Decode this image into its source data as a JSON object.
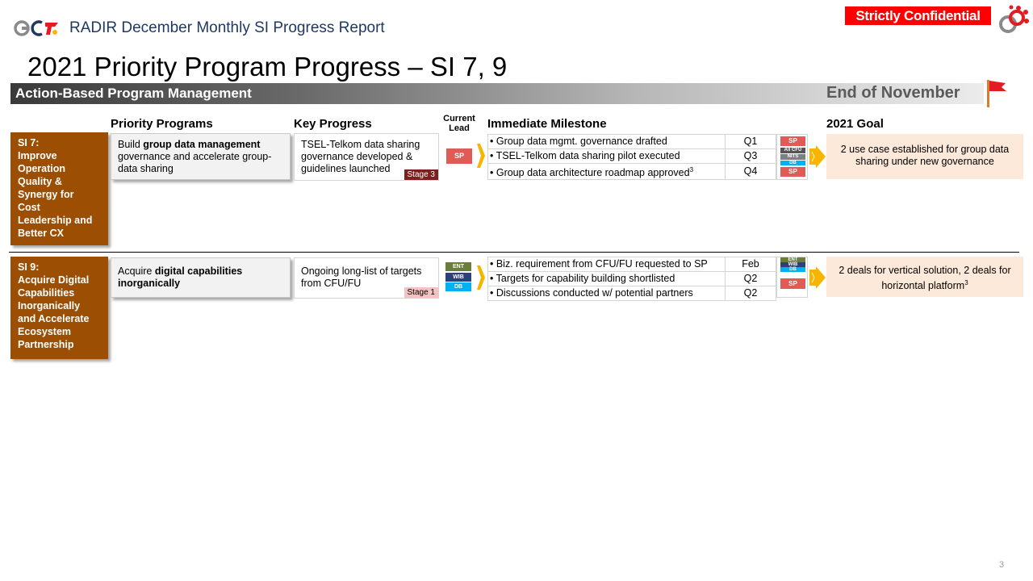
{
  "header": {
    "report_title": "RADIR December Monthly SI Progress Report",
    "confidential": "Strictly Confidential",
    "page_title": "2021 Priority Program Progress – SI 7, 9",
    "banner_left": "Action-Based Program Management",
    "banner_right": "End of November"
  },
  "columns": {
    "priority_programs": "Priority Programs",
    "key_progress": "Key Progress",
    "current_lead_1": "Current",
    "current_lead_2": "Lead",
    "immediate_milestone": "Immediate Milestone",
    "goal": "2021 Goal"
  },
  "si7": {
    "label": "SI 7:",
    "title_lines": [
      "Improve",
      "Operation",
      "Quality &",
      "Synergy for",
      "Cost",
      "Leadership and",
      "Better CX"
    ],
    "program_pre": "Build ",
    "program_bold": "group data management",
    "program_post": " governance and accelerate group-data sharing",
    "progress": "TSEL-Telkom data sharing governance developed & guidelines launched",
    "stage": "Stage 3",
    "lead": "SP",
    "milestones": [
      {
        "text": "• Group data mgmt. governance drafted",
        "q": "Q1"
      },
      {
        "text": "• TSEL-Telkom data sharing pilot executed",
        "q": "Q3"
      },
      {
        "text": "• Group data architecture roadmap approved",
        "sup": "3",
        "q": "Q4"
      }
    ],
    "owners": [
      "SP",
      "All CFU",
      "NITS",
      "DB",
      "SP"
    ],
    "goal": "2 use case established for group data sharing under new governance"
  },
  "si9": {
    "label": "SI 9:",
    "title_lines": [
      "Acquire Digital",
      "Capabilities",
      "Inorganically",
      "and Accelerate",
      "Ecosystem",
      "Partnership"
    ],
    "program_pre": "Acquire ",
    "program_bold": "digital capabilities inorganically",
    "progress": "Ongoing long-list of targets from CFU/FU",
    "stage": "Stage 1",
    "leads": [
      "ENT",
      "WIB",
      "DB"
    ],
    "milestones": [
      {
        "text": "• Biz. requirement from CFU/FU requested to SP",
        "q": "Feb"
      },
      {
        "text": "• Targets for capability building shortlisted",
        "q": "Q2"
      },
      {
        "text": "• Discussions conducted w/ potential partners",
        "q": "Q2"
      }
    ],
    "owners": [
      "ENT",
      "WIB",
      "DB",
      "SP"
    ],
    "goal": "2 deals for vertical solution, 2 deals for horizontal platform",
    "goal_sup": "3"
  },
  "logo_text": "GCT",
  "page_number": "3",
  "colors": {
    "si_brown": "#9c4f03",
    "sp_red": "#e05a56",
    "ent_green": "#6b7d3a",
    "wib_navy": "#2e3f7b",
    "db_blue": "#00b0f0",
    "stage3": "#7b1f1f",
    "stage1": "#f4c2c2",
    "goal_peach": "#fce9d9",
    "arrow_yellow": "#f7b500"
  }
}
